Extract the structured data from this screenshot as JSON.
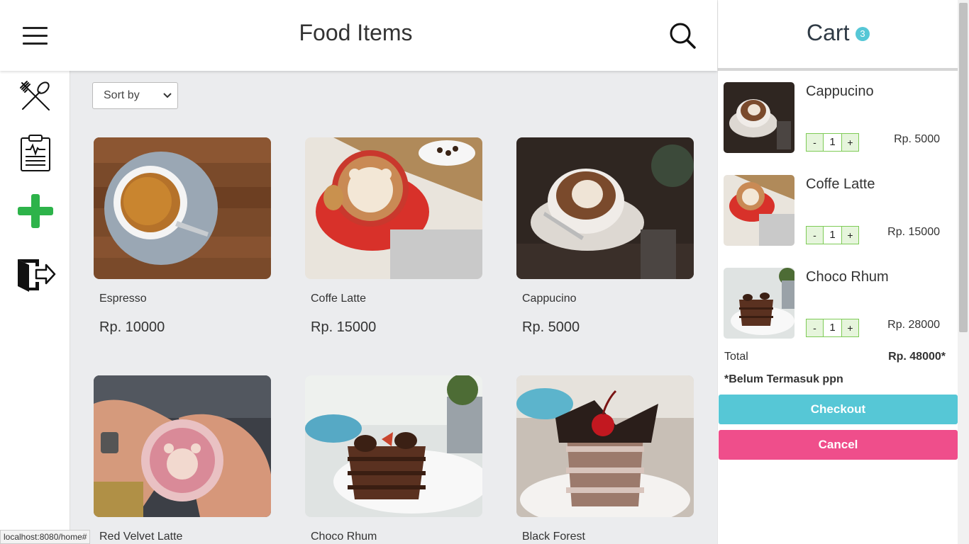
{
  "header": {
    "title": "Food Items"
  },
  "sidebar": {
    "items": [
      {
        "icon": "utensils-icon"
      },
      {
        "icon": "clipboard-icon"
      },
      {
        "icon": "plus-icon"
      },
      {
        "icon": "logout-icon"
      }
    ]
  },
  "main": {
    "sort_label": "Sort by",
    "products": [
      {
        "name": "Espresso",
        "price": "Rp. 10000"
      },
      {
        "name": "Coffe Latte",
        "price": "Rp. 15000"
      },
      {
        "name": "Cappucino",
        "price": "Rp. 5000"
      },
      {
        "name": "Red Velvet Latte",
        "price": ""
      },
      {
        "name": "Choco Rhum",
        "price": ""
      },
      {
        "name": "Black Forest",
        "price": ""
      }
    ]
  },
  "cart": {
    "title": "Cart",
    "count": "3",
    "items": [
      {
        "name": "Cappucino",
        "qty": "1",
        "minus": "-",
        "plus": "+",
        "price": "Rp. 5000"
      },
      {
        "name": "Coffe Latte",
        "qty": "1",
        "minus": "-",
        "plus": "+",
        "price": "Rp. 15000"
      },
      {
        "name": "Choco Rhum",
        "qty": "1",
        "minus": "-",
        "plus": "+",
        "price": "Rp. 28000"
      }
    ],
    "total_label": "Total",
    "total_value": "Rp. 48000*",
    "tax_note": "*Belum Termasuk ppn",
    "checkout_label": "Checkout",
    "cancel_label": "Cancel"
  },
  "statusbar": {
    "url": "localhost:8080/home#"
  },
  "colors": {
    "accent": "#56c7d6",
    "danger": "#ef4e8b",
    "add": "#2db34a",
    "background": "#ebecee"
  }
}
